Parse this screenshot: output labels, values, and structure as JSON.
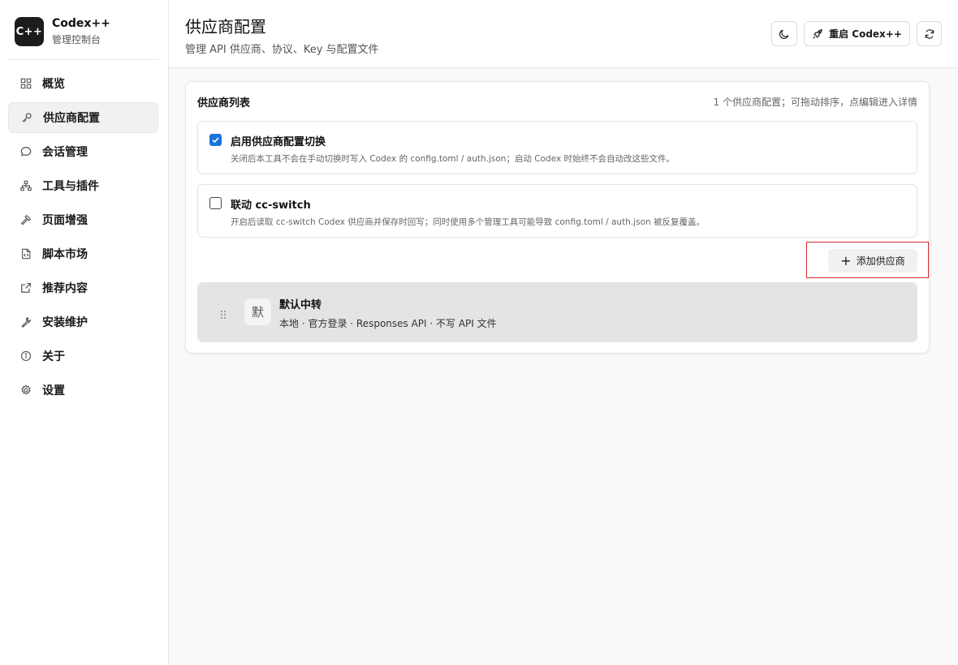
{
  "brand": {
    "logo": "C++",
    "name": "Codex++",
    "subtitle": "管理控制台"
  },
  "sidebar": {
    "items": [
      {
        "label": "概览",
        "icon": "grid-icon"
      },
      {
        "label": "供应商配置",
        "icon": "key-icon",
        "active": true
      },
      {
        "label": "会话管理",
        "icon": "chat-bubble-icon"
      },
      {
        "label": "工具与插件",
        "icon": "sitemap-icon"
      },
      {
        "label": "页面增强",
        "icon": "hammer-icon"
      },
      {
        "label": "脚本市场",
        "icon": "script-file-icon"
      },
      {
        "label": "推荐内容",
        "icon": "external-link-icon"
      },
      {
        "label": "安装维护",
        "icon": "wrench-icon"
      },
      {
        "label": "关于",
        "icon": "info-icon"
      },
      {
        "label": "设置",
        "icon": "gear-icon"
      }
    ]
  },
  "header": {
    "title": "供应商配置",
    "subtitle": "管理 API 供应商、协议、Key 与配置文件",
    "restart_label": "重启 Codex++",
    "theme_icon": "moon-icon",
    "restart_icon": "rocket-icon",
    "refresh_icon": "refresh-icon"
  },
  "card": {
    "title": "供应商列表",
    "hint": "1 个供应商配置；可拖动排序，点编辑进入详情",
    "options": [
      {
        "checked": true,
        "title": "启用供应商配置切换",
        "description": "关闭后本工具不会在手动切换时写入 Codex 的 config.toml / auth.json；启动 Codex 时始终不会自动改这些文件。"
      },
      {
        "checked": false,
        "title": "联动 cc-switch",
        "description": "开启后读取 cc-switch Codex 供应商并保存时回写；同时使用多个管理工具可能导致 config.toml / auth.json 被反复覆盖。"
      }
    ],
    "add_label": "添加供应商",
    "providers": [
      {
        "avatar": "默",
        "name": "默认中转",
        "meta": "本地 · 官方登录 · Responses API · 不写 API 文件"
      }
    ]
  },
  "colors": {
    "accent": "#1a73d9",
    "highlight": "#d32f2f",
    "sidebar_active_bg": "#f1f1f1"
  }
}
